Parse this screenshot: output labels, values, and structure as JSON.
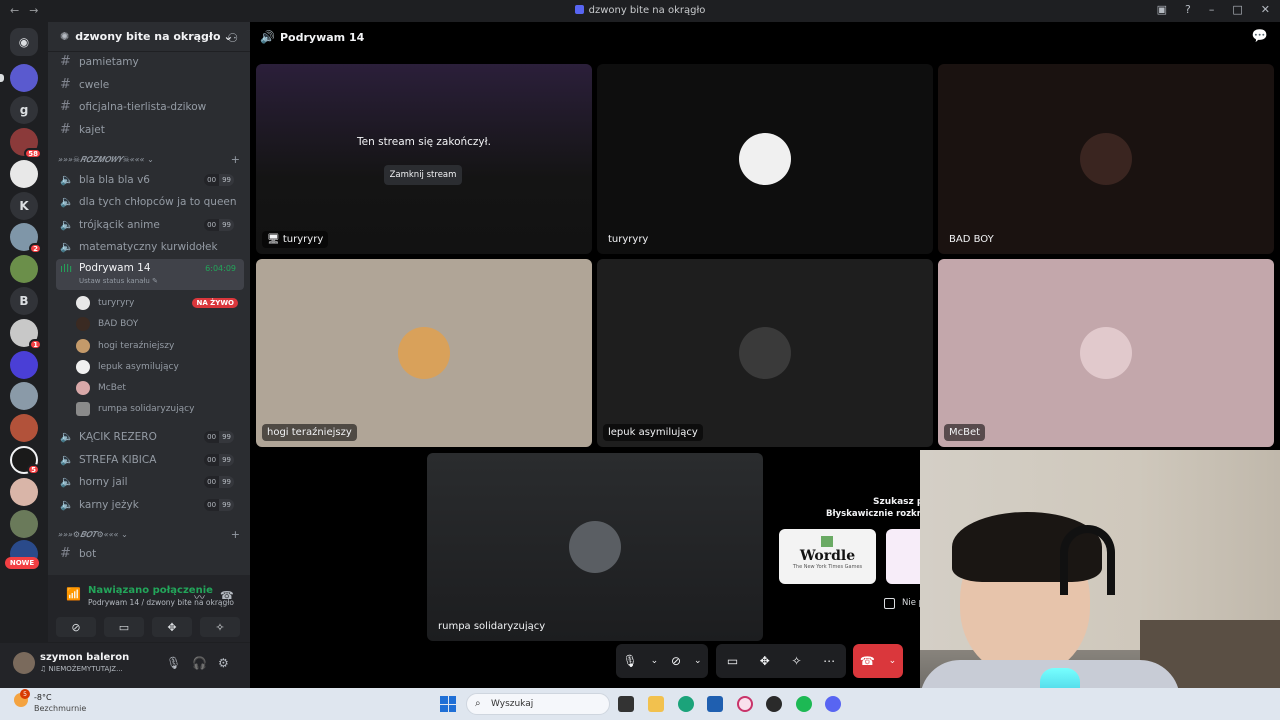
{
  "window": {
    "title": "dzwony bite na okrągło"
  },
  "rail": {
    "letters": [
      "g",
      "K",
      "B"
    ],
    "badges": [
      "58",
      "2",
      "1",
      "5"
    ],
    "nowe": "NOWE"
  },
  "server": {
    "name": "dzwony bite na okrągło"
  },
  "text_channels": [
    "pamietamy",
    "cwele",
    "oficjalna-tierlista-dzikow",
    "kajet"
  ],
  "category_voice": "»»»☠𝑹𝑶𝒁𝑴𝑶𝑾𝒀☠«««",
  "voice_channels": [
    {
      "name": "bla bla bla v6",
      "a": "00",
      "b": "99"
    },
    {
      "name": "dla tych chłopców ja to queen",
      "a": "",
      "b": ""
    },
    {
      "name": "trójkącik anime",
      "a": "00",
      "b": "99"
    },
    {
      "name": "matematyczny kurwidołek",
      "a": "",
      "b": ""
    }
  ],
  "active_channel": {
    "name": "Podrywam 14",
    "timer": "6:04:09",
    "status": "Ustaw status kanału"
  },
  "members": [
    {
      "name": "turyryry",
      "live": "NA ŻYWO"
    },
    {
      "name": "BAD BOY",
      "live": ""
    },
    {
      "name": "hogi teraźniejszy",
      "live": ""
    },
    {
      "name": "lepuk asymilujący",
      "live": ""
    },
    {
      "name": "McBet",
      "live": ""
    },
    {
      "name": "rumpa solidaryzujący",
      "live": ""
    }
  ],
  "voice_channels2": [
    {
      "name": "KĄCIK REZERO",
      "a": "00",
      "b": "99"
    },
    {
      "name": "STREFA KIBICA",
      "a": "00",
      "b": "99"
    },
    {
      "name": "horny jail",
      "a": "00",
      "b": "99"
    },
    {
      "name": "karny jeżyk",
      "a": "00",
      "b": "99"
    }
  ],
  "category_bot": "»»»⚙𝑩𝑶𝑻⚙«««",
  "bot_channel": "bot",
  "voice_panel": {
    "title": "Nawiązano połączenie",
    "sub": "Podrywam 14 / dzwony bite na okrągło"
  },
  "user_panel": {
    "name": "szymon baleron",
    "status": "NIEMOŻEMYTUTAJZ..."
  },
  "stage": {
    "title": "Podrywam 14",
    "ended": "Ten stream się zakończył.",
    "close": "Zamknij stream",
    "tiles": [
      "turyryry",
      "turyryry",
      "BAD BOY",
      "hogi teraźniejszy",
      "lepuk asymilujący",
      "McBet",
      "rumpa solidaryzujący"
    ]
  },
  "activity": {
    "q1": "Szukasz po",
    "q2": "Błyskawicznie rozkręć",
    "wordle": "Wordle",
    "wordle_sub": "The New York Times Games",
    "checkbox": "Nie p"
  },
  "taskbar": {
    "weather_badge": "5",
    "temp": "-8°C",
    "desc": "Bezchmurnie",
    "search": "Wyszukaj"
  },
  "colors": {
    "accent": "#5865f2",
    "green": "#23a55a",
    "red": "#da373c"
  }
}
